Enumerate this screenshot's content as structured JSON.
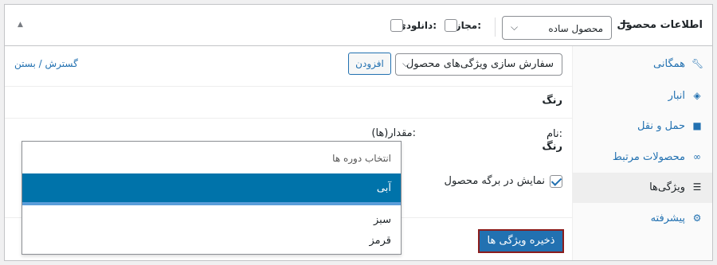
{
  "header": {
    "title": "اطلاعات محصول",
    "dash": "—",
    "product_type": "محصول ساده",
    "virtual_label": "مجازی:",
    "downloadable_label": "دانلودی:"
  },
  "tabs": [
    {
      "label": "همگانی",
      "icon": "wrench-icon"
    },
    {
      "label": "انبار",
      "icon": "tag-icon"
    },
    {
      "label": "حمل و نقل",
      "icon": "truck-icon"
    },
    {
      "label": "محصولات مرتبط",
      "icon": "link-icon"
    },
    {
      "label": "ویژگی‌ها",
      "icon": "list-icon"
    },
    {
      "label": "پیشرفته",
      "icon": "gear-icon"
    }
  ],
  "toolbar": {
    "attribute_select": "سفارش سازی ویژگی‌های محصول",
    "add_button": "افزودن",
    "expand_link": "گسترش / بستن"
  },
  "attribute": {
    "title": "رنگ",
    "name_label": "نام:",
    "name_value": "رنگ",
    "values_label": "مقدار(ها):",
    "visible_label": "نمایش در برگه محصول"
  },
  "dropdown": {
    "placeholder": "انتخاب دوره ها",
    "options": [
      "آبی",
      "سبز",
      "قرمز"
    ],
    "highlighted": "آبی"
  },
  "save_button": "ذخیره ویژگی ها",
  "colors": {
    "accent": "#2271b1",
    "highlight": "#0073aa",
    "save_border": "#8b1d1d"
  }
}
